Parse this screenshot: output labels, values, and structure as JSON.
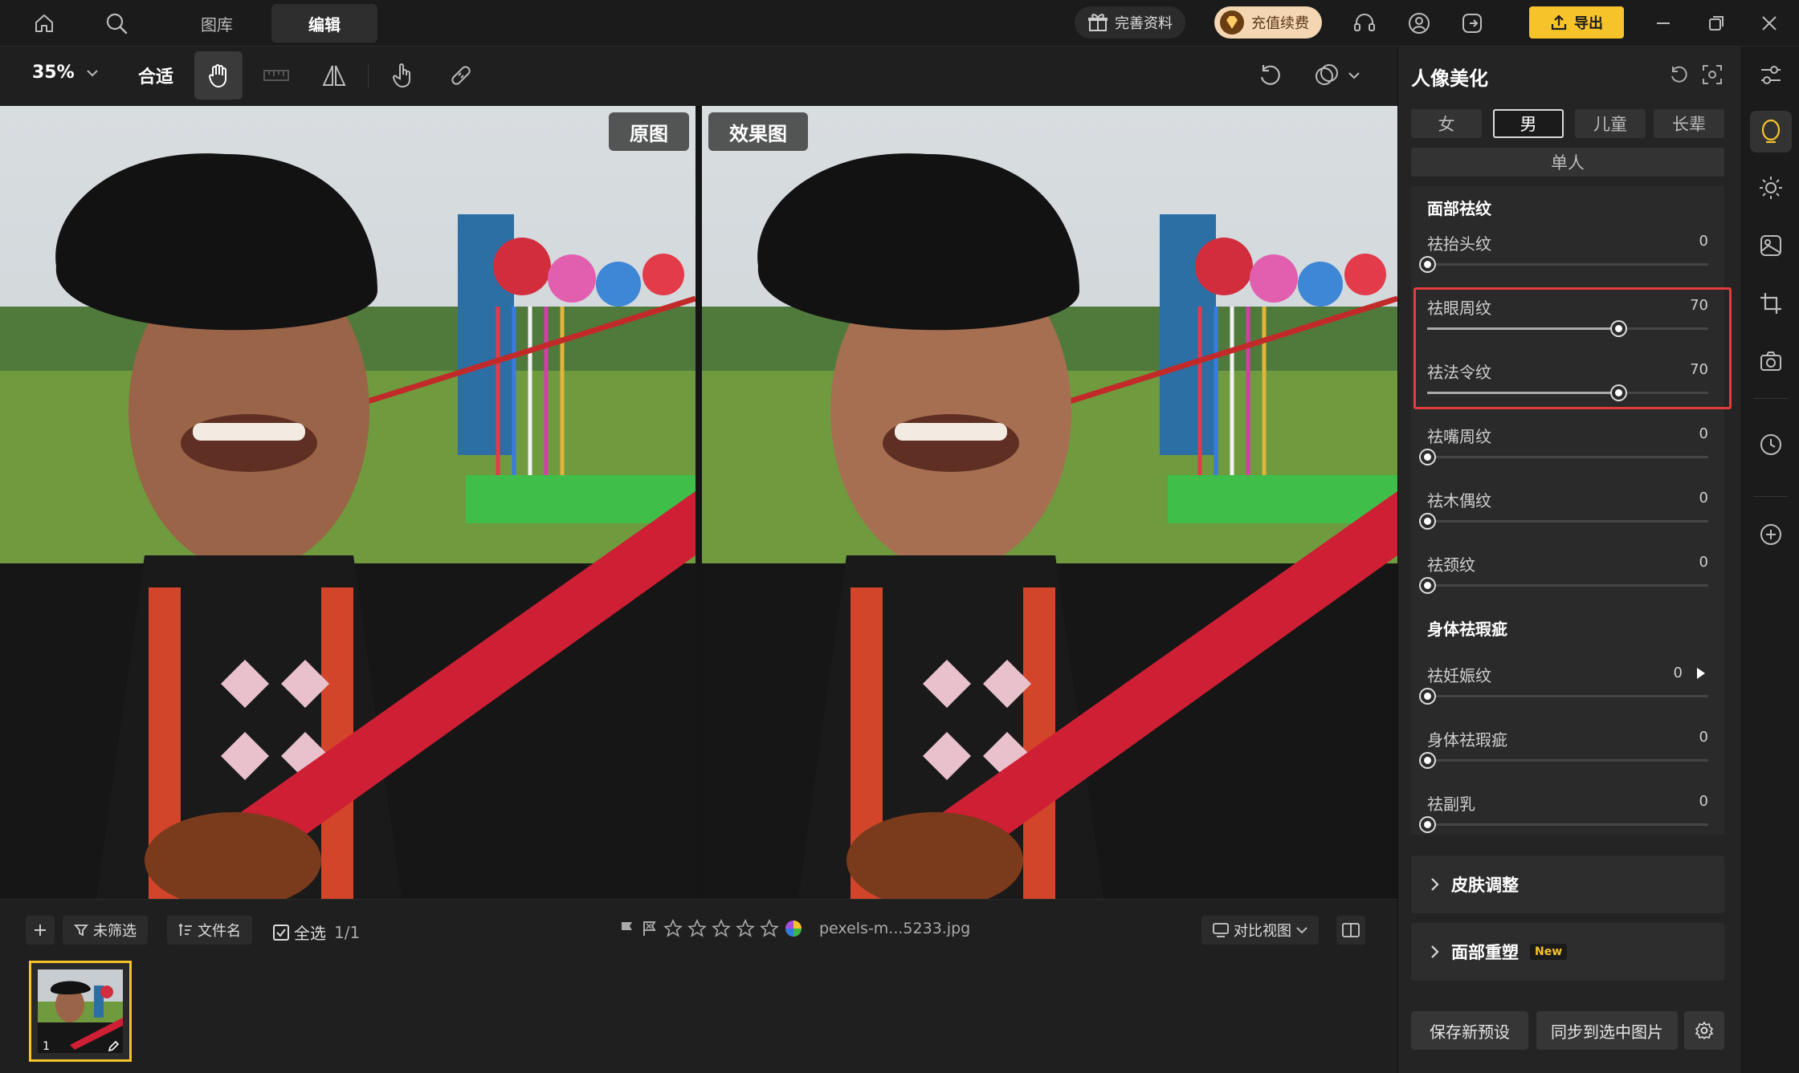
{
  "topbar": {
    "tabs": [
      {
        "label": "图库"
      },
      {
        "label": "编辑"
      }
    ],
    "complete_profile": "完善资料",
    "recharge": "充值续费",
    "export": "导出",
    "accent": "#f6c32a"
  },
  "toolbar": {
    "zoom": "35%",
    "fit": "合适"
  },
  "canvas": {
    "original_label": "原图",
    "effect_label": "效果图"
  },
  "bottombar": {
    "filter": "未筛选",
    "sort": "文件名",
    "select_all": "全选",
    "count": "1/1",
    "filename": "pexels-m...5233.jpg",
    "view_mode": "对比视图",
    "thumb_index": "1"
  },
  "panel": {
    "title": "人像美化",
    "gender_tabs": [
      "女",
      "男",
      "儿童",
      "长辈"
    ],
    "mode": "单人",
    "face_section": {
      "title": "面部祛纹",
      "sliders": [
        {
          "label": "祛抬头纹",
          "value": "0"
        },
        {
          "label": "祛眼周纹",
          "value": "70"
        },
        {
          "label": "祛法令纹",
          "value": "70"
        },
        {
          "label": "祛嘴周纹",
          "value": "0"
        },
        {
          "label": "祛木偶纹",
          "value": "0"
        },
        {
          "label": "祛颈纹",
          "value": "0"
        }
      ]
    },
    "body_section": {
      "title": "身体祛瑕疵",
      "sliders": [
        {
          "label": "祛妊娠纹",
          "value": "0"
        },
        {
          "label": "身体祛瑕疵",
          "value": "0"
        },
        {
          "label": "祛副乳",
          "value": "0"
        }
      ]
    },
    "skin_section": "皮肤调整",
    "reshape_section": "面部重塑",
    "new_badge": "New",
    "save_preset": "保存新预设",
    "sync": "同步到选中图片",
    "highlight_color": "#e23c3c"
  }
}
